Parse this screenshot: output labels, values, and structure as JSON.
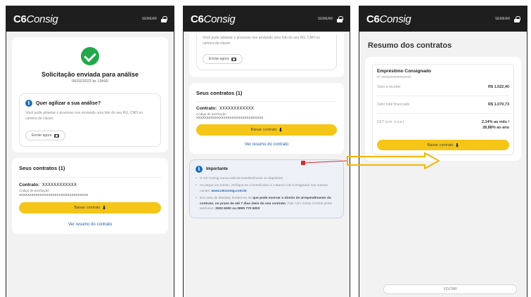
{
  "brand": {
    "c6": "C6",
    "consig": "Consig"
  },
  "topbar": {
    "exit_label": "SEMEAR"
  },
  "screen1": {
    "status_title": "Solicitação enviada para análise",
    "status_date": "06/02/2023 às 19h00",
    "speed_title": "Quer agilizar a sua análise?",
    "speed_text": "Você pode adiantar o processo nos enviando uma foto do seu RG, CNH ou carteira de classe.",
    "send_photo_button": "Enviar agora",
    "contracts_title": "Seus contratos (1)",
    "contract_label": "Contrato:",
    "contract_number": "XXXXXXXXXXXX",
    "code_label": "Código de averbação",
    "code_value": "XXXXXXXXXXXXXXXXXXXXXXXXXXXXXXXXX",
    "download_button": "Baixar contrato",
    "summary_link": "Ver resumo do contrato"
  },
  "screen2": {
    "top_text": "Você pode adiantar o processo nos enviando uma foto do seu RG, CNH ou carteira de classe.",
    "send_photo_button": "Enviar agora",
    "contracts_title": "Seus contratos (1)",
    "contract_label": "Contrato:",
    "contract_number": "XXXXXXXXXXXX",
    "code_label": "Código de averbação",
    "code_value": "XXXXXXXXXXXXXXXXXXXXXXXXXXXXXXXX",
    "download_button": "Baixar contrato",
    "summary_link": "Ver resumo do contrato",
    "important_title": "Importante",
    "bullets": {
      "b1": "O C6 Consig nunca solicita transferências ou depósitos.",
      "b2": "Ao pegar um boleto, verifique se o beneficiário é o Banco C6 Consignado nos nossos canais:",
      "b2_link": "www.c6consig.com.br",
      "b3_start": "Em caso de dúvidas, lembre-se de",
      "b3_strong": "que pode exercer o direito de arrependimento do contrato, no prazo de até 7 dias úteis do seu contrato.",
      "b3_end": "Fale com nossa Central pelos telefones:",
      "b3_phones": "3003 6000 ou 0800 770 6000"
    }
  },
  "screen3": {
    "title": "Resumo dos contratos",
    "product_name": "Empréstimo Consignado",
    "product_number": "Nº 00000000000000000",
    "rows": [
      {
        "label": "Valor a receber",
        "value": "R$ 1.022,40"
      },
      {
        "label": "Valor total financiado",
        "value": "R$ 1.070,73"
      },
      {
        "label": "CET (a.m. e a.a.)",
        "value": "2,14% ao mês / 28,88% ao ano"
      }
    ],
    "download_button": "Baixar contrato",
    "bottom_button": "VOLTAR"
  },
  "colors": {
    "topbar": "#1e1e1e",
    "accent_yellow": "#f5c518",
    "success_green": "#22a84a",
    "info_blue": "#1e6fb8",
    "annotation_orange": "#f2b705",
    "annotation_red": "#d62b2b"
  }
}
